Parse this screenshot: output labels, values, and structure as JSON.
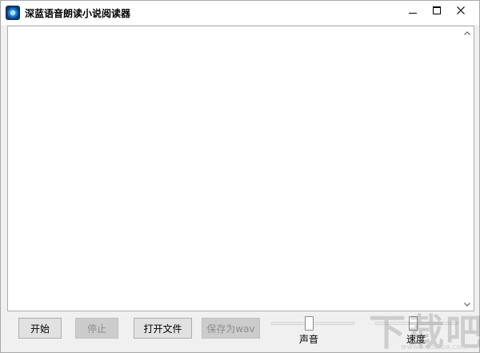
{
  "window": {
    "title": "深蓝语音朗读小说阅读器",
    "icon": "app-speaker-icon",
    "controls": {
      "minimize": "minimize-icon",
      "maximize": "maximize-icon",
      "close": "close-icon"
    }
  },
  "editor": {
    "value": "",
    "scroll_up": "chevron-up-icon",
    "scroll_down": "chevron-down-icon"
  },
  "toolbar": {
    "start_label": "开始",
    "stop_label": "停止",
    "open_file_label": "打开文件",
    "save_wav_label": "保存为wav"
  },
  "sliders": {
    "volume": {
      "label": "声音",
      "level": 0.45
    },
    "speed": {
      "label": "速度",
      "level": 0.45
    }
  },
  "watermark": {
    "text": "下载吧",
    "url": "www.xiazaiba.com"
  }
}
